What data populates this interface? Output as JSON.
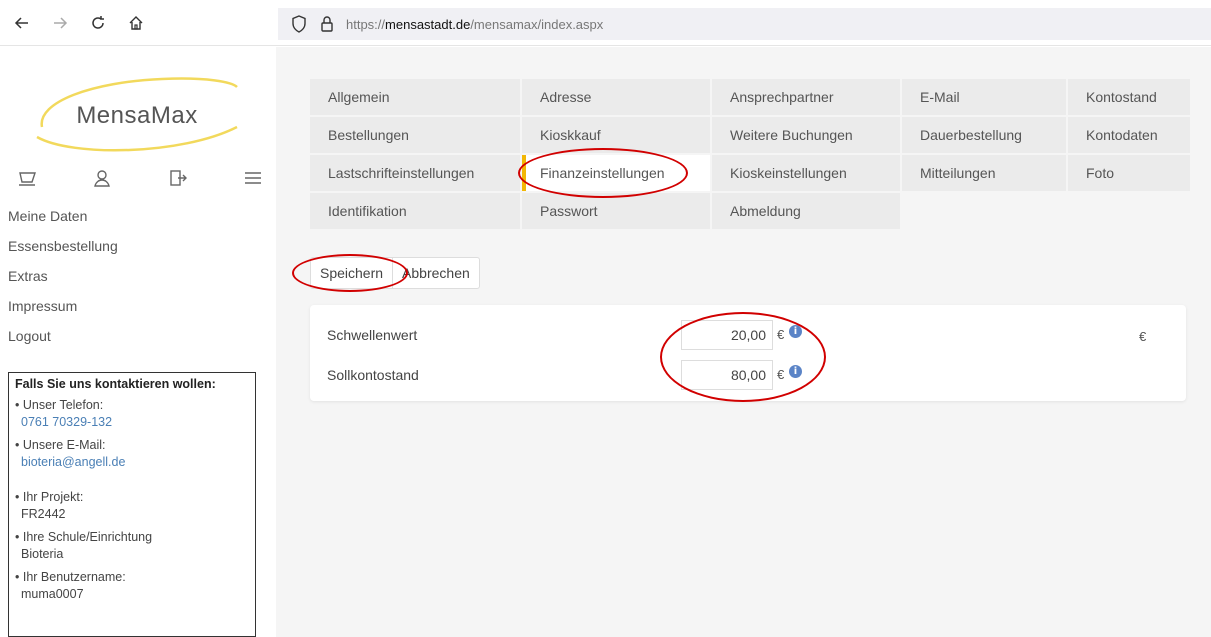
{
  "browser": {
    "url_scheme": "https://",
    "url_host": "mensastadt.de",
    "url_path": "/mensamax/index.aspx"
  },
  "sidebar": {
    "logo_text": "MensaMax",
    "menu": [
      "Meine Daten",
      "Essensbestellung",
      "Extras",
      "Impressum",
      "Logout"
    ],
    "contact": {
      "title": "Falls Sie uns kontaktieren wollen:",
      "phone_label": "• Unser Telefon:",
      "phone": "0761 70329-132",
      "email_label": "• Unsere E-Mail:",
      "email": "bioteria@angell.de",
      "project_label": "• Ihr Projekt:",
      "project": "FR2442",
      "school_label": "• Ihre Schule/Einrichtung",
      "school": "Bioteria",
      "user_label": "• Ihr Benutzername:",
      "user": "muma0007"
    }
  },
  "tabs": [
    "Allgemein",
    "Adresse",
    "Ansprechpartner",
    "E-Mail",
    "Kontostand",
    "Bestellungen",
    "Kioskkauf",
    "Weitere Buchungen",
    "Dauerbestellung",
    "Kontodaten",
    "Lastschrifteinstellungen",
    "Finanzeinstellungen",
    "Kioskeinstellungen",
    "Mitteilungen",
    "Foto",
    "Identifikation",
    "Passwort",
    "Abmeldung"
  ],
  "active_tab": "Finanzeinstellungen",
  "actions": {
    "save": "Speichern",
    "cancel": "Abbrechen"
  },
  "form": {
    "threshold_label": "Schwellenwert",
    "threshold_value": "20,00",
    "overdraft_label": "Sollkontostand",
    "overdraft_value": "80,00",
    "currency": "€",
    "info_glyph": "i"
  },
  "colors": {
    "active_tab_marker": "#f2b705",
    "annotation": "#d10000",
    "link": "#4a7fb5"
  }
}
